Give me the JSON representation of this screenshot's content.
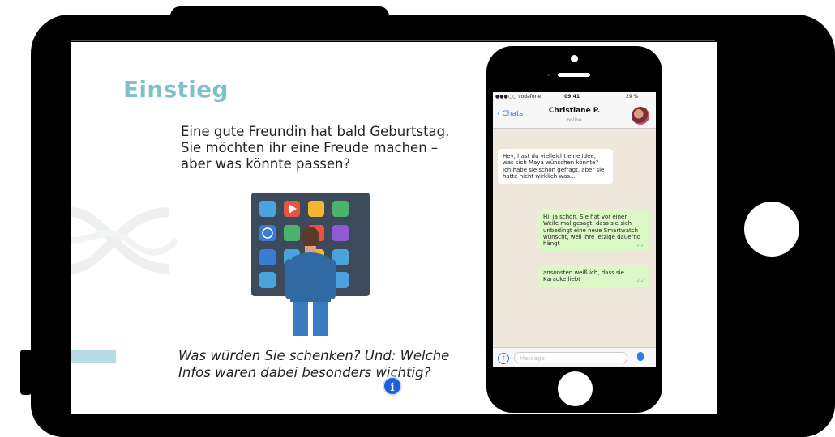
{
  "slide": {
    "title": "Einstieg",
    "intro": "Eine gute Freundin hat bald Geburtstag. Sie möchten ihr eine Freude machen – aber was könnte passen?",
    "question": "Was würden Sie schenken? Und: Welche Infos waren dabei besonders wichtig?",
    "info_icon": "i"
  },
  "phone": {
    "status": {
      "carrier": "●●●○○ vodafone",
      "time": "09:41",
      "battery": "29 %"
    },
    "header": {
      "back_label": "Chats",
      "contact_name": "Christiane P.",
      "contact_status": "online"
    },
    "messages": [
      {
        "direction": "in",
        "text": "Hey, hast du vielleicht eine Idee, was sich Maya wünschen könnte? Ich habe sie schon gefragt, aber sie hatte nicht wirklich was..."
      },
      {
        "direction": "out",
        "text": "Hi, ja schon. Sie hat vor einer Weile mal gesagt, dass sie sich unbedingt eine neue Smartwatch wünscht, weil ihre jetzige dauernd hängt"
      },
      {
        "direction": "out",
        "text": "ansonsten weiß ich, dass sie Karaoke liebt"
      }
    ],
    "input_placeholder": "Message"
  },
  "colors": {
    "title": "#7fc1c9",
    "accent_bar": "#b7dde2",
    "info_button": "#1f5fd6",
    "bubble_out": "#dcf8c6"
  }
}
